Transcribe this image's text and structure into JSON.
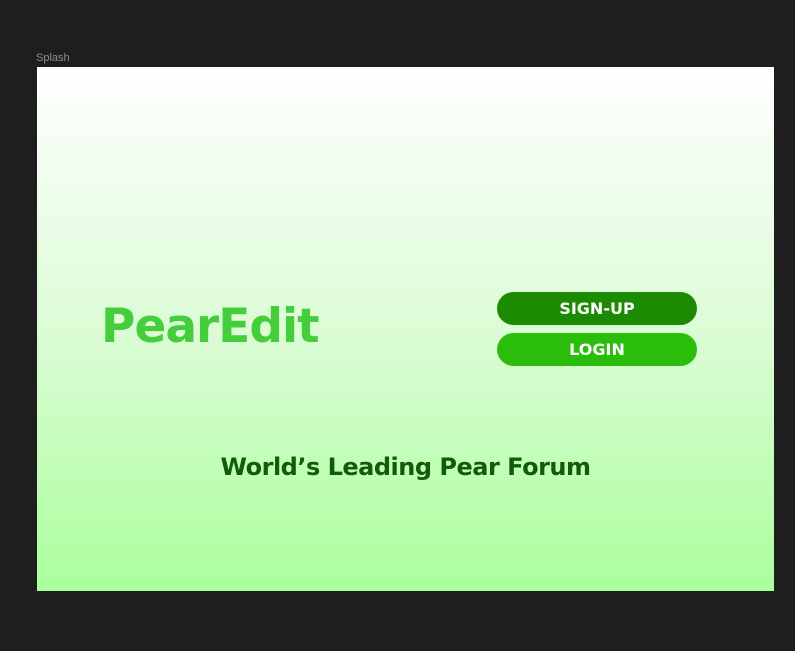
{
  "frame": {
    "label": "Splash"
  },
  "splash": {
    "logo_text": "PearEdit",
    "signup_label": "SIGN-UP",
    "login_label": "LOGIN",
    "tagline": "World’s Leading Pear Forum"
  },
  "colors": {
    "canvas_background": "#1e1e1e",
    "gradient_top": "#ffffff",
    "gradient_bottom": "#aaff9d",
    "logo": "#46cd3c",
    "signup_button": "#1c8a03",
    "login_button": "#2bbd0b",
    "tagline": "#105d05"
  }
}
